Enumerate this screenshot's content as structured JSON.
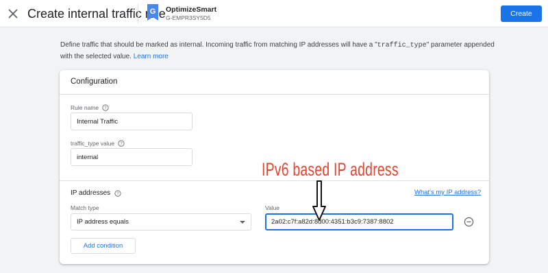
{
  "header": {
    "title": "Create internal traffic rule",
    "property_name": "OptimizeSmart",
    "property_id": "G-EMPR3SY5D5",
    "create_label": "Create"
  },
  "description": {
    "text_before": "Define traffic that should be marked as internal. Incoming traffic from matching IP addresses will have a \"",
    "code": "traffic_type",
    "text_after": "\" parameter appended with the selected value.",
    "link": "Learn more"
  },
  "configuration": {
    "title": "Configuration",
    "rule_name_label": "Rule name",
    "rule_name_value": "Internal Traffic",
    "traffic_type_label": "traffic_type value",
    "traffic_type_value": "internal"
  },
  "ip_addresses": {
    "title": "IP addresses",
    "my_ip_link": "What's my IP address?",
    "match_type_label": "Match type",
    "match_type_value": "IP address equals",
    "value_label": "Value",
    "value": "2a02:c7f:a82d:8d00:4351:b3c9:7387:8802",
    "add_condition_label": "Add condition"
  },
  "annotation": {
    "text": "IPv6 based IP address",
    "color": "#e8412c"
  },
  "colors": {
    "accent": "#1a73e8",
    "background": "#f1f3f4"
  },
  "icons": [
    "close-icon",
    "google-analytics-property-icon",
    "help-icon",
    "chevron-down-icon",
    "remove-circle-icon",
    "arrow-down-icon"
  ]
}
